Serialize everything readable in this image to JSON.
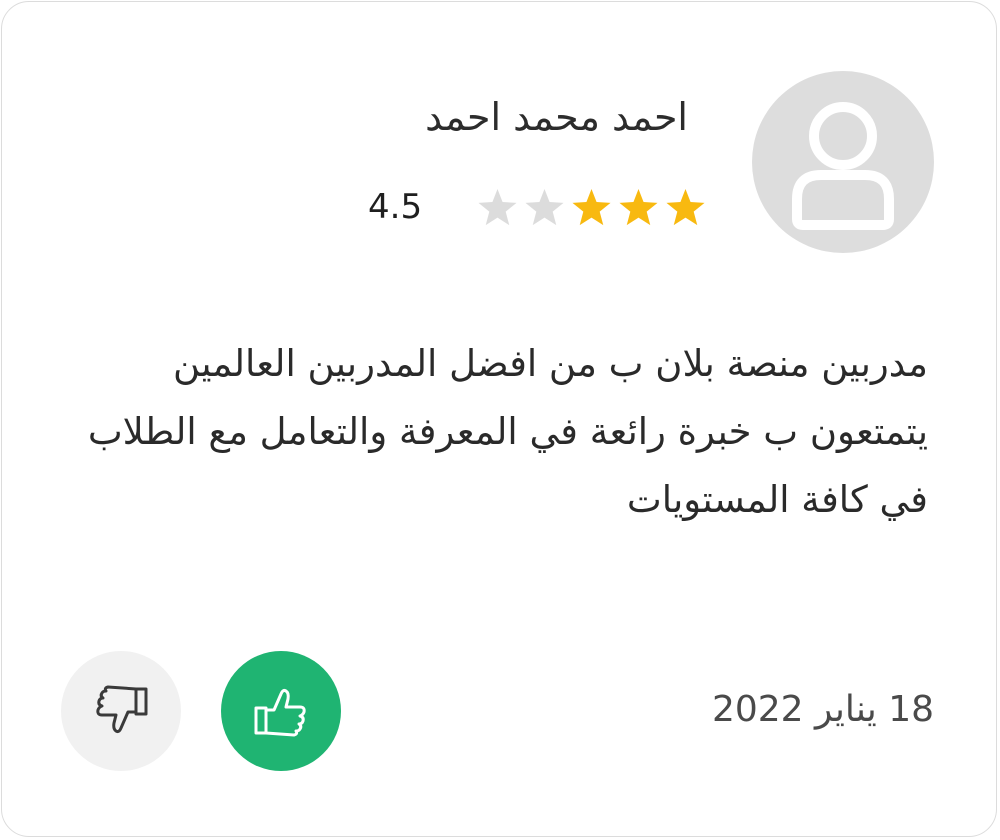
{
  "review": {
    "reviewer_name": "احمد محمد احمد",
    "rating_value": "4.5",
    "rating_filled_stars": 3,
    "rating_total_stars": 5,
    "text": "مدربين منصة بلان ب من افضل المدربين العالمين يتمتعون ب خبرة رائعة في المعرفة والتعامل مع الطلاب في كافة المستويات",
    "date": "18 يناير 2022"
  },
  "icons": {
    "avatar": "user-silhouette-icon",
    "star_filled": "star-filled-icon",
    "star_empty": "star-empty-icon",
    "like": "thumbs-up-icon",
    "dislike": "thumbs-down-icon"
  },
  "colors": {
    "star_filled": "#f8b910",
    "star_empty": "#dcdcdc",
    "like_bg": "#1fb472",
    "dislike_bg": "#f1f1f1",
    "avatar_bg": "#dddddd"
  }
}
